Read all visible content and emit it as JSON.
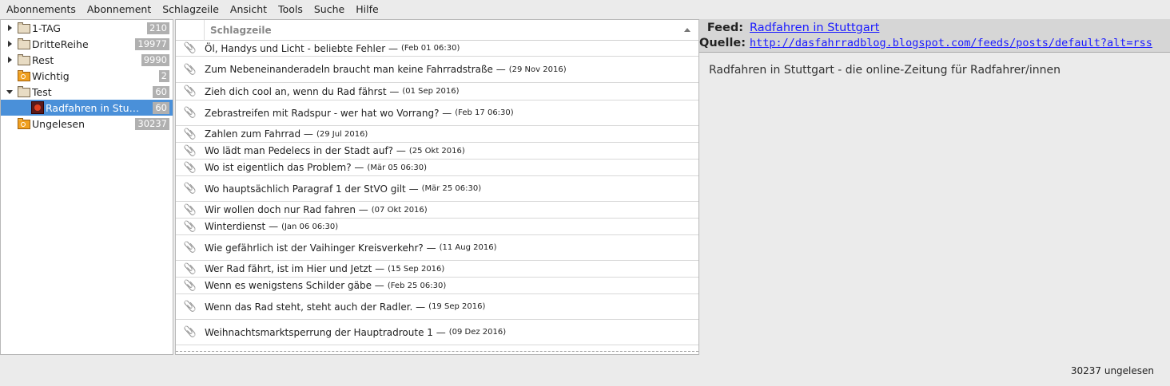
{
  "menu": [
    "Abonnements",
    "Abonnement",
    "Schlagzeile",
    "Ansicht",
    "Tools",
    "Suche",
    "Hilfe"
  ],
  "tree": [
    {
      "label": "1-TAG",
      "count": "210",
      "type": "folder",
      "expander": "collapsed"
    },
    {
      "label": "DritteReihe",
      "count": "19977",
      "type": "folder",
      "expander": "collapsed"
    },
    {
      "label": "Rest",
      "count": "9990",
      "type": "folder",
      "expander": "collapsed"
    },
    {
      "label": "Wichtig",
      "count": "2",
      "type": "search-folder",
      "expander": "none"
    },
    {
      "label": "Test",
      "count": "60",
      "type": "folder",
      "expander": "expanded"
    },
    {
      "label": "Radfahren in Stu…",
      "count": "60",
      "type": "feed",
      "expander": "none",
      "selected": true
    },
    {
      "label": "Ungelesen",
      "count": "30237",
      "type": "search-folder",
      "expander": "none"
    }
  ],
  "headlines_header": "Schlagzeile",
  "headlines": [
    {
      "title": "Öl, Handys und Licht - beliebte Fehler —",
      "date": "(Feb 01 06:30)",
      "h": 20
    },
    {
      "title": "Zum Nebeneinanderadeln braucht man keine Fahrradstraße —",
      "date": "(29 Nov 2016)",
      "h": 33
    },
    {
      "title": "Zieh dich cool an, wenn du Rad fährst —",
      "date": "(01 Sep 2016)",
      "h": 22
    },
    {
      "title": "Zebrastreifen mit Radspur - wer hat wo Vorrang? —",
      "date": "(Feb 17 06:30)",
      "h": 32
    },
    {
      "title": "Zahlen zum Fahrrad —",
      "date": "(29 Jul 2016)",
      "h": 21
    },
    {
      "title": "Wo lädt man Pedelecs in der Stadt auf? —",
      "date": "(25 Okt 2016)",
      "h": 21
    },
    {
      "title": "Wo ist eigentlich das Problem? —",
      "date": "(Mär 05 06:30)",
      "h": 21
    },
    {
      "title": "Wo hauptsächlich Paragraf 1 der StVO gilt —",
      "date": "(Mär 25 06:30)",
      "h": 32
    },
    {
      "title": "Wir wollen doch nur Rad fahren —",
      "date": "(07 Okt 2016)",
      "h": 21
    },
    {
      "title": "Winterdienst —",
      "date": "(Jan 06 06:30)",
      "h": 21
    },
    {
      "title": "Wie gefährlich ist der Vaihinger Kreisverkehr? —",
      "date": "(11 Aug 2016)",
      "h": 32
    },
    {
      "title": "Wer Rad fährt, ist im Hier und Jetzt —",
      "date": "(15 Sep 2016)",
      "h": 21
    },
    {
      "title": "Wenn es wenigstens Schilder gäbe —",
      "date": "(Feb 25 06:30)",
      "h": 21
    },
    {
      "title": "Wenn das Rad steht, steht auch der Radler. —",
      "date": "(19 Sep 2016)",
      "h": 32
    },
    {
      "title": "Weihnachtsmarktsperrung der Hauptradroute 1 —",
      "date": "(09 Dez 2016)",
      "h": 32
    }
  ],
  "feed": {
    "feed_label": "Feed:",
    "feed_name": "Radfahren in Stuttgart",
    "source_label": "Quelle:",
    "source_url": "http://dasfahrradblog.blogspot.com/feeds/posts/default?alt=rss",
    "description": "Radfahren in Stuttgart - die online-Zeitung für Radfahrer/innen"
  },
  "status": "30237 ungelesen"
}
